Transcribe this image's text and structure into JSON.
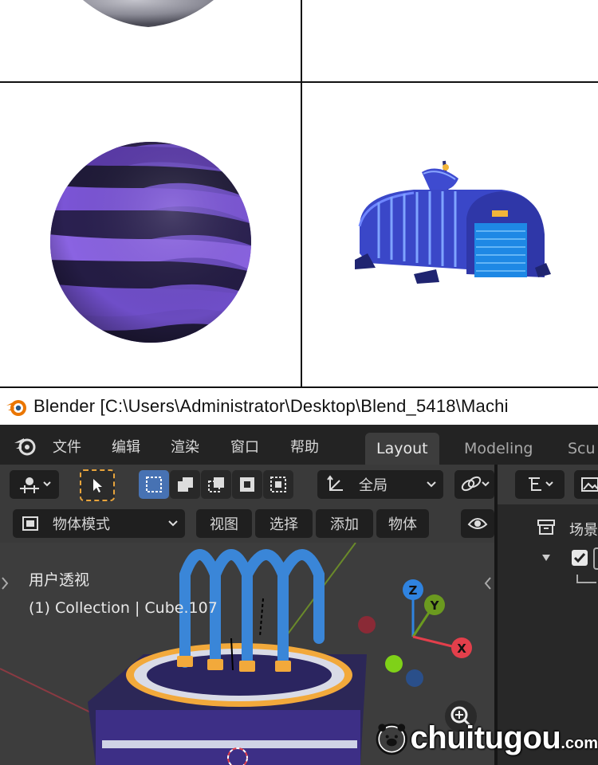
{
  "window": {
    "title": "Blender [C:\\Users\\Administrator\\Desktop\\Blend_5418\\Machi"
  },
  "topbar": {
    "menus": [
      "文件",
      "编辑",
      "渲染",
      "窗口",
      "帮助"
    ],
    "workspace_tabs": [
      "Layout",
      "Modeling",
      "Scu"
    ],
    "active_tab": "Layout"
  },
  "toolbar": {
    "transform_orientation": "全局"
  },
  "view_header": {
    "mode": "物体模式",
    "menus": [
      "视图",
      "选择",
      "添加",
      "物体"
    ]
  },
  "viewport": {
    "view_name": "用户透视",
    "collection_info": "(1) Collection | Cube.107",
    "gizmo": {
      "z": "Z",
      "y": "Y",
      "x": "X"
    }
  },
  "outliner": {
    "scene_label": "场景"
  },
  "watermark": {
    "text": "chuitugou",
    "suffix": ".com"
  },
  "colors": {
    "accent_blue": "#4772b3",
    "header_dark": "#232323",
    "viewport_bg": "#3d3d3d",
    "axis_x": "#e33f4b",
    "axis_y": "#6b9a1f",
    "axis_z": "#2f83e0"
  }
}
